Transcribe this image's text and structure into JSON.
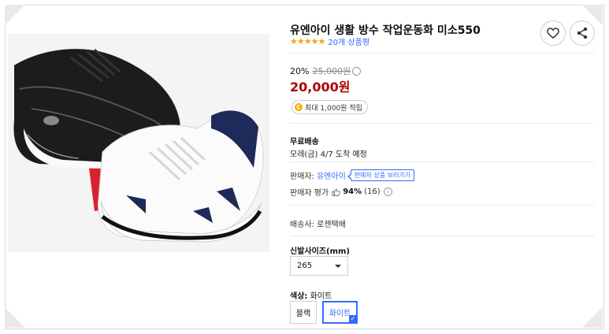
{
  "product": {
    "title": "유엔아이 생활 방수 작업운동화 미소550",
    "stars": "★★★★★",
    "review_link": "20개 상품평"
  },
  "price": {
    "discount_rate": "20%",
    "original_price": "25,000원",
    "info_icon": "ⓘ",
    "sale_price": "20,000원"
  },
  "cash": {
    "coin_symbol": "C",
    "label": "최대 1,000원 적립"
  },
  "shipping": {
    "label": "무료배송",
    "arrival": "모레(금) 4/7 도착 예정"
  },
  "seller": {
    "prefix": "판매자:",
    "name": "유엔아이",
    "tooltip": "판매자 상품 보러가기",
    "rating_prefix": "판매자 평가",
    "rating_pct": "94%",
    "rating_count": "(16)"
  },
  "delivery": {
    "label": "배송사: 로젠택배"
  },
  "size": {
    "label": "신발사이즈(mm)",
    "selected": "265"
  },
  "color": {
    "label_prefix": "색상:",
    "selected": "화이트",
    "options": [
      "블랙",
      "화이트"
    ]
  },
  "colors": {
    "accent": "#346aff",
    "price_red": "#ae0000",
    "star": "#f3a51a"
  },
  "icons": {
    "wishlist": "heart-icon",
    "share": "share-icon",
    "seller_rating": "thumbs-up-icon",
    "dropdown": "chevron-down-icon"
  }
}
